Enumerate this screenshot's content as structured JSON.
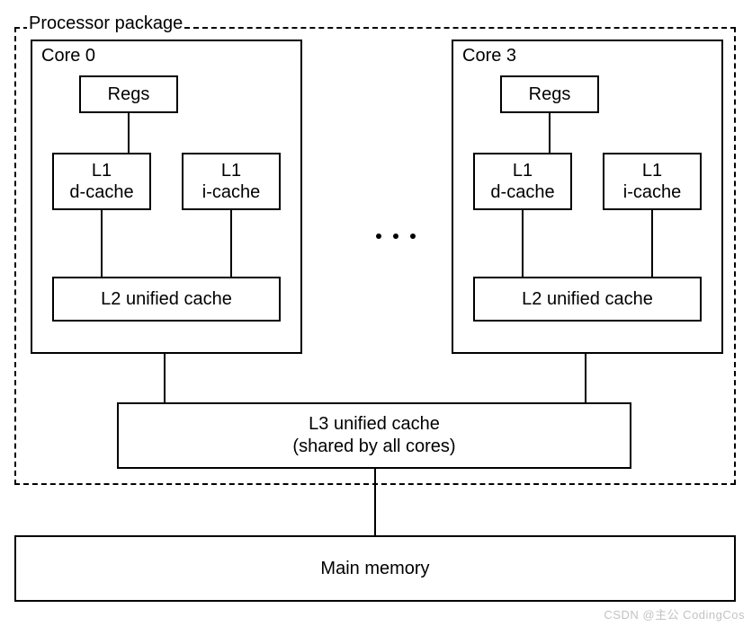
{
  "package_label": "Processor package",
  "cores": [
    {
      "label": "Core 0",
      "regs": "Regs",
      "l1d_line1": "L1",
      "l1d_line2": "d-cache",
      "l1i_line1": "L1",
      "l1i_line2": "i-cache",
      "l2": "L2 unified cache"
    },
    {
      "label": "Core 3",
      "regs": "Regs",
      "l1d_line1": "L1",
      "l1d_line2": "d-cache",
      "l1i_line1": "L1",
      "l1i_line2": "i-cache",
      "l2": "L2 unified cache"
    }
  ],
  "l3_line1": "L3 unified cache",
  "l3_line2": "(shared by all cores)",
  "main_memory": "Main memory",
  "watermark": "CSDN @主公 CodingCos"
}
